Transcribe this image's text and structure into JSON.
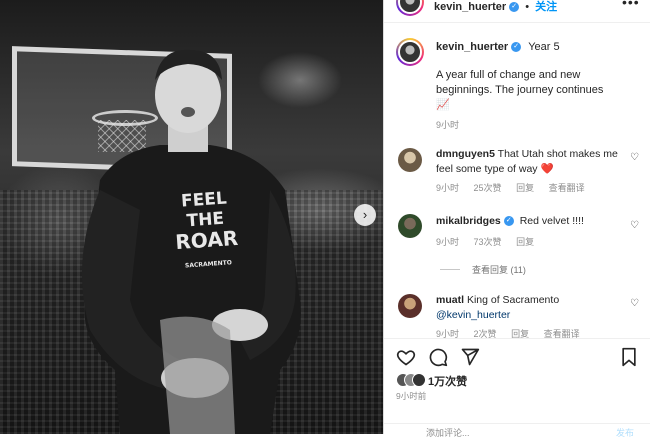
{
  "header": {
    "username": "kevin_huerter",
    "follow_label": "关注",
    "more_icon": "more-dots-icon"
  },
  "post": {
    "username": "kevin_huerter",
    "caption_title": "Year 5",
    "caption_body": "A year full of change and new beginnings. The journey continues",
    "caption_emoji": "📈",
    "time": "9小时"
  },
  "comments": [
    {
      "username": "dmnguyen5",
      "text": "That Utah shot makes me feel some type of way",
      "emoji": "❤️",
      "time": "9小时",
      "likes": "25次赞",
      "reply_label": "回复",
      "translate_label": "查看翻译"
    },
    {
      "username": "mikalbridges",
      "text": "Red velvet !!!!",
      "time": "9小时",
      "likes": "73次赞",
      "reply_label": "回复",
      "view_replies": "查看回复 (11)"
    },
    {
      "username": "muatl",
      "text": "King of Sacramento",
      "mention": "@kevin_huerter",
      "time": "9小时",
      "likes": "2次赞",
      "reply_label": "回复",
      "translate_label": "查看翻译"
    }
  ],
  "actions": {
    "like_icon": "heart-outline-icon",
    "comment_icon": "comment-bubble-icon",
    "share_icon": "send-paper-plane-icon",
    "save_icon": "bookmark-icon",
    "likes_count": "1万次赞",
    "posted_time": "9小时前",
    "add_comment_placeholder": "添加评论...",
    "post_label": "发布"
  },
  "photo": {
    "shirt_text_line1": "FEEL THE",
    "shirt_text_line2": "ROAR",
    "shirt_sub": "SACRAMENTO",
    "next_icon": "chevron-right-icon"
  },
  "colors": {
    "accent": "#0095f6",
    "verified": "#3897f0",
    "heart": "#ed4956",
    "muted": "#8e8e8e"
  }
}
